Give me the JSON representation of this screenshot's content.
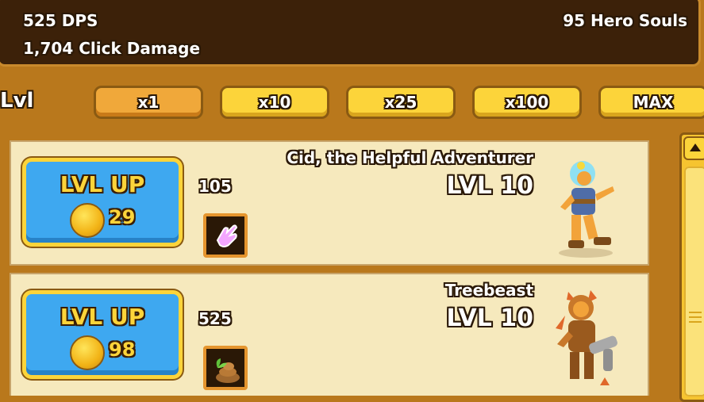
{
  "stats": {
    "dps": "525 DPS",
    "click_damage": "1,704 Click Damage",
    "hero_souls": "95 Hero Souls"
  },
  "level_bar": {
    "label": "Lvl",
    "multipliers": [
      "x1",
      "x10",
      "x25",
      "x100",
      "MAX"
    ],
    "selected": "x1"
  },
  "heroes": [
    {
      "name": "Cid, the Helpful Adventurer",
      "level": "LVL 10",
      "damage": "105",
      "button_label": "LVL UP",
      "cost": "29",
      "skill_icon": "pointer-hand-icon"
    },
    {
      "name": "Treebeast",
      "level": "LVL 10",
      "damage": "525",
      "button_label": "LVL UP",
      "cost": "98",
      "skill_icon": "seedling-pile-icon"
    }
  ],
  "colors": {
    "panel_bg": "#3c2109",
    "button_yellow": "#fcd43a",
    "button_selected": "#f0a83a",
    "levelup_blue": "#3ea8f0",
    "row_bg": "#f6e9bd"
  }
}
